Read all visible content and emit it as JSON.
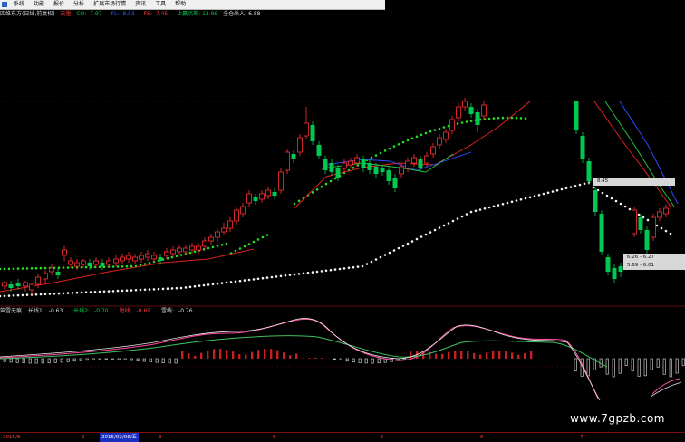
{
  "menu": {
    "items": [
      "系统",
      "功能",
      "报价",
      "分析",
      "扩展市场行情",
      "资讯",
      "工具",
      "帮助"
    ]
  },
  "infobar": {
    "title": "四维东方(日线,前复权)",
    "tag": "天量",
    "co_label": "CO:",
    "co_value": "7.97",
    "h_label": "FL:",
    "h_value": "8.53",
    "fs_label": "FS:",
    "fs_value": "7.45",
    "note1": "止赢点剩: 13.96",
    "note2": "全仓杀入: 6.88"
  },
  "indicator": {
    "name": "笛雪无痕",
    "l1_label": "长线1:",
    "l1_value": "-0.63",
    "l2_label": "长线2:",
    "l2_value": "-0.70",
    "l3_label": "短线:",
    "l3_value": "-0.69",
    "l4_label": "雪线:",
    "l4_value": "-0.76"
  },
  "price_boxes": {
    "b1": "8.45",
    "b2": "6.26 - 6.27",
    "b3": "5.69 - 6.01"
  },
  "watermark": "www.7gpzb.com",
  "timeaxis": {
    "labels": [
      "2015/8",
      "2",
      "2015/02/06/五",
      "3",
      "4",
      "5",
      "6",
      "7"
    ],
    "selected_index": 2
  },
  "colors": {
    "up": "#ff3030",
    "down": "#00c850",
    "grid": "#7a1010"
  }
}
